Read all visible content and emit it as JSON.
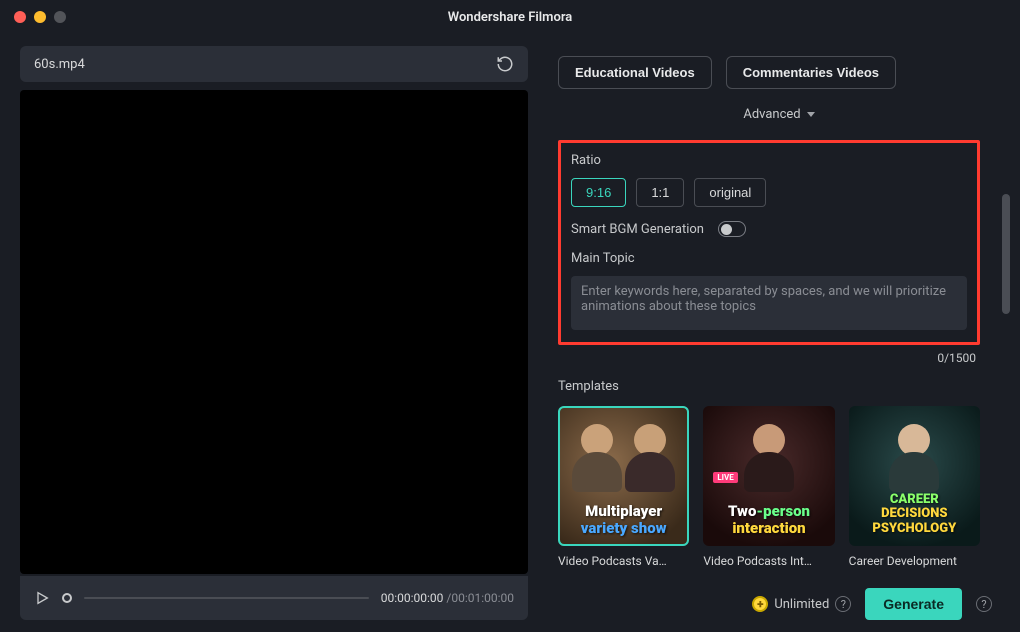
{
  "window": {
    "title": "Wondershare Filmora"
  },
  "file": {
    "name": "60s.mp4"
  },
  "player": {
    "current_time": "00:00:00:00",
    "total_time": "/00:01:00:00"
  },
  "chips": {
    "educational": "Educational Videos",
    "commentaries": "Commentaries Videos"
  },
  "advanced_label": "Advanced",
  "ratio": {
    "label": "Ratio",
    "options": {
      "r916": "9:16",
      "r11": "1:1",
      "original": "original"
    },
    "selected": "9:16"
  },
  "bgm": {
    "label": "Smart BGM Generation",
    "enabled": false
  },
  "main_topic": {
    "label": "Main Topic",
    "placeholder": "Enter keywords here, separated by spaces, and we will prioritize animations about these topics",
    "count_text": "0/1500"
  },
  "templates": {
    "label": "Templates",
    "items": [
      {
        "title": "Video Podcasts Va…",
        "overlay_line1_a": "Multiplayer",
        "overlay_line2_a": "variety ",
        "overlay_line2_b": "show",
        "selected": true
      },
      {
        "title": "Video Podcasts Int…",
        "badge": "LIVE",
        "overlay_line1_a": "Two",
        "overlay_line1_b": "-person",
        "overlay_line2_a": "interaction",
        "selected": false
      },
      {
        "title": "Career Development",
        "overlay_line1_a": "CAREER ",
        "overlay_line1_b": "DECISIONS",
        "overlay_line2_a": "PSYCHOLOGY",
        "selected": false
      }
    ]
  },
  "footer": {
    "unlimited": "Unlimited",
    "generate": "Generate"
  }
}
